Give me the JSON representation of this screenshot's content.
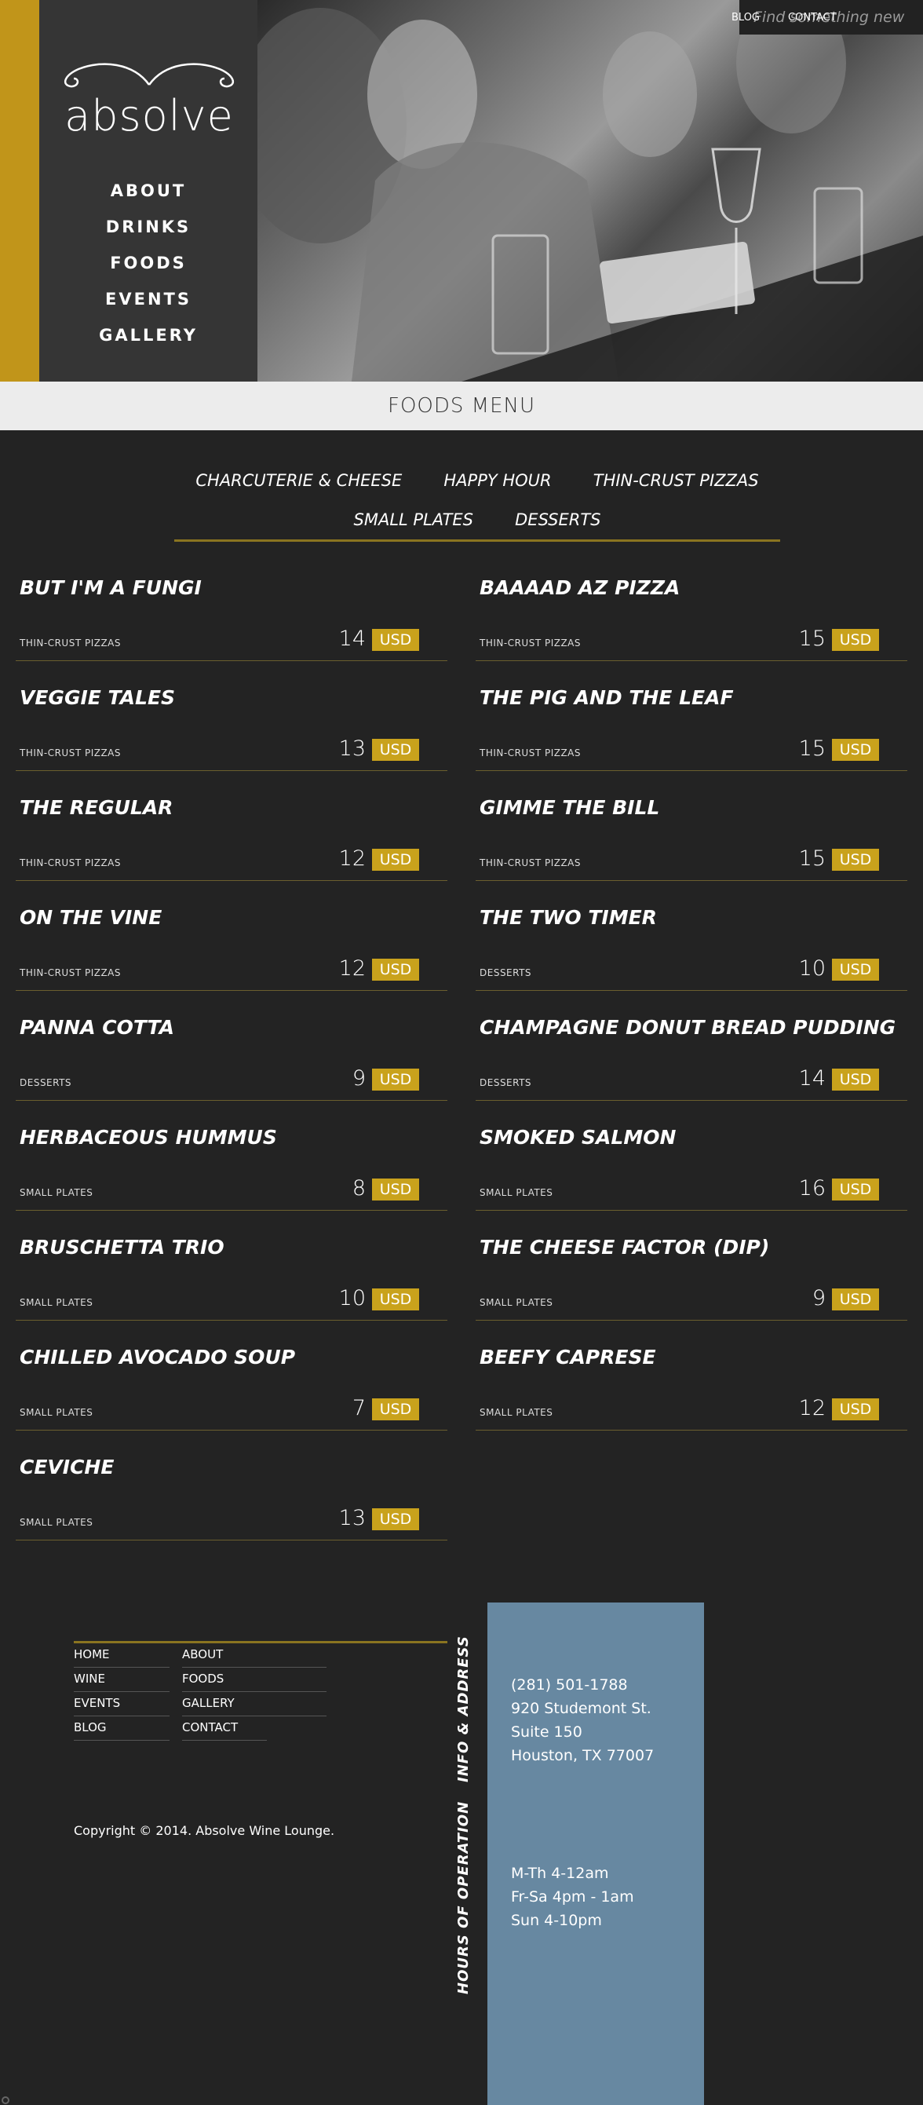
{
  "brand": {
    "logo_text": "absolve"
  },
  "main_nav": [
    {
      "label": "ABOUT"
    },
    {
      "label": "DRINKS"
    },
    {
      "label": "FOODS"
    },
    {
      "label": "EVENTS"
    },
    {
      "label": "GALLERY"
    }
  ],
  "search": {
    "placeholder": "Find something new",
    "icon": "search-icon"
  },
  "top_links": [
    {
      "label": "BLOG"
    },
    {
      "label": "CONTACT"
    }
  ],
  "page_title": "FOODS MENU",
  "filters": {
    "row1": [
      "CHARCUTERIE & CHEESE",
      "HAPPY HOUR",
      "THIN-CRUST PIZZAS"
    ],
    "row2": [
      "SMALL PLATES",
      "DESSERTS"
    ]
  },
  "menu_items": [
    {
      "name": "BUT I'M A FUNGI",
      "category": "THIN-CRUST PIZZAS",
      "price": "14",
      "currency": "USD"
    },
    {
      "name": "BAAAAD AZ PIZZA",
      "category": "THIN-CRUST PIZZAS",
      "price": "15",
      "currency": "USD"
    },
    {
      "name": "VEGGIE TALES",
      "category": "THIN-CRUST PIZZAS",
      "price": "13",
      "currency": "USD"
    },
    {
      "name": "THE PIG AND THE LEAF",
      "category": "THIN-CRUST PIZZAS",
      "price": "15",
      "currency": "USD"
    },
    {
      "name": "THE REGULAR",
      "category": "THIN-CRUST PIZZAS",
      "price": "12",
      "currency": "USD"
    },
    {
      "name": "GIMME THE BILL",
      "category": "THIN-CRUST PIZZAS",
      "price": "15",
      "currency": "USD"
    },
    {
      "name": "ON THE VINE",
      "category": "THIN-CRUST PIZZAS",
      "price": "12",
      "currency": "USD"
    },
    {
      "name": "THE TWO TIMER",
      "category": "DESSERTS",
      "price": "10",
      "currency": "USD"
    },
    {
      "name": "PANNA COTTA",
      "category": "DESSERTS",
      "price": "9",
      "currency": "USD"
    },
    {
      "name": "CHAMPAGNE DONUT BREAD PUDDING",
      "category": "DESSERTS",
      "price": "14",
      "currency": "USD"
    },
    {
      "name": "HERBACEOUS HUMMUS",
      "category": "SMALL PLATES",
      "price": "8",
      "currency": "USD"
    },
    {
      "name": "SMOKED SALMON",
      "category": "SMALL PLATES",
      "price": "16",
      "currency": "USD"
    },
    {
      "name": "BRUSCHETTA TRIO",
      "category": "SMALL PLATES",
      "price": "10",
      "currency": "USD"
    },
    {
      "name": "THE CHEESE FACTOR (DIP)",
      "category": "SMALL PLATES",
      "price": "9",
      "currency": "USD"
    },
    {
      "name": "CHILLED AVOCADO SOUP",
      "category": "SMALL PLATES",
      "price": "7",
      "currency": "USD"
    },
    {
      "name": "BEEFY CAPRESE",
      "category": "SMALL PLATES",
      "price": "12",
      "currency": "USD"
    },
    {
      "name": "CEVICHE",
      "category": "SMALL PLATES",
      "price": "13",
      "currency": "USD"
    }
  ],
  "footer": {
    "links": [
      [
        "HOME",
        "ABOUT"
      ],
      [
        "WINE",
        "FOODS"
      ],
      [
        "EVENTS",
        "GALLERY"
      ],
      [
        "BLOG",
        "CONTACT"
      ]
    ],
    "copyright": "Copyright © 2014. Absolve Wine Lounge.",
    "info_label": "INFO & ADDRESS",
    "hours_label": "HOURS OF OPERATION",
    "address_lines": [
      "(281) 501-1788",
      "920 Studemont St.",
      "Suite 150",
      "Houston, TX 77007"
    ],
    "hours_lines": [
      "M-Th 4-12am",
      "Fr-Sa 4pm - 1am",
      "Sun 4-10pm"
    ]
  },
  "colors": {
    "accent_gold": "#c1951a",
    "sidebar_bg": "#353535",
    "page_bg": "#232323",
    "info_panel": "#6788a1",
    "title_bar": "#ececec"
  }
}
